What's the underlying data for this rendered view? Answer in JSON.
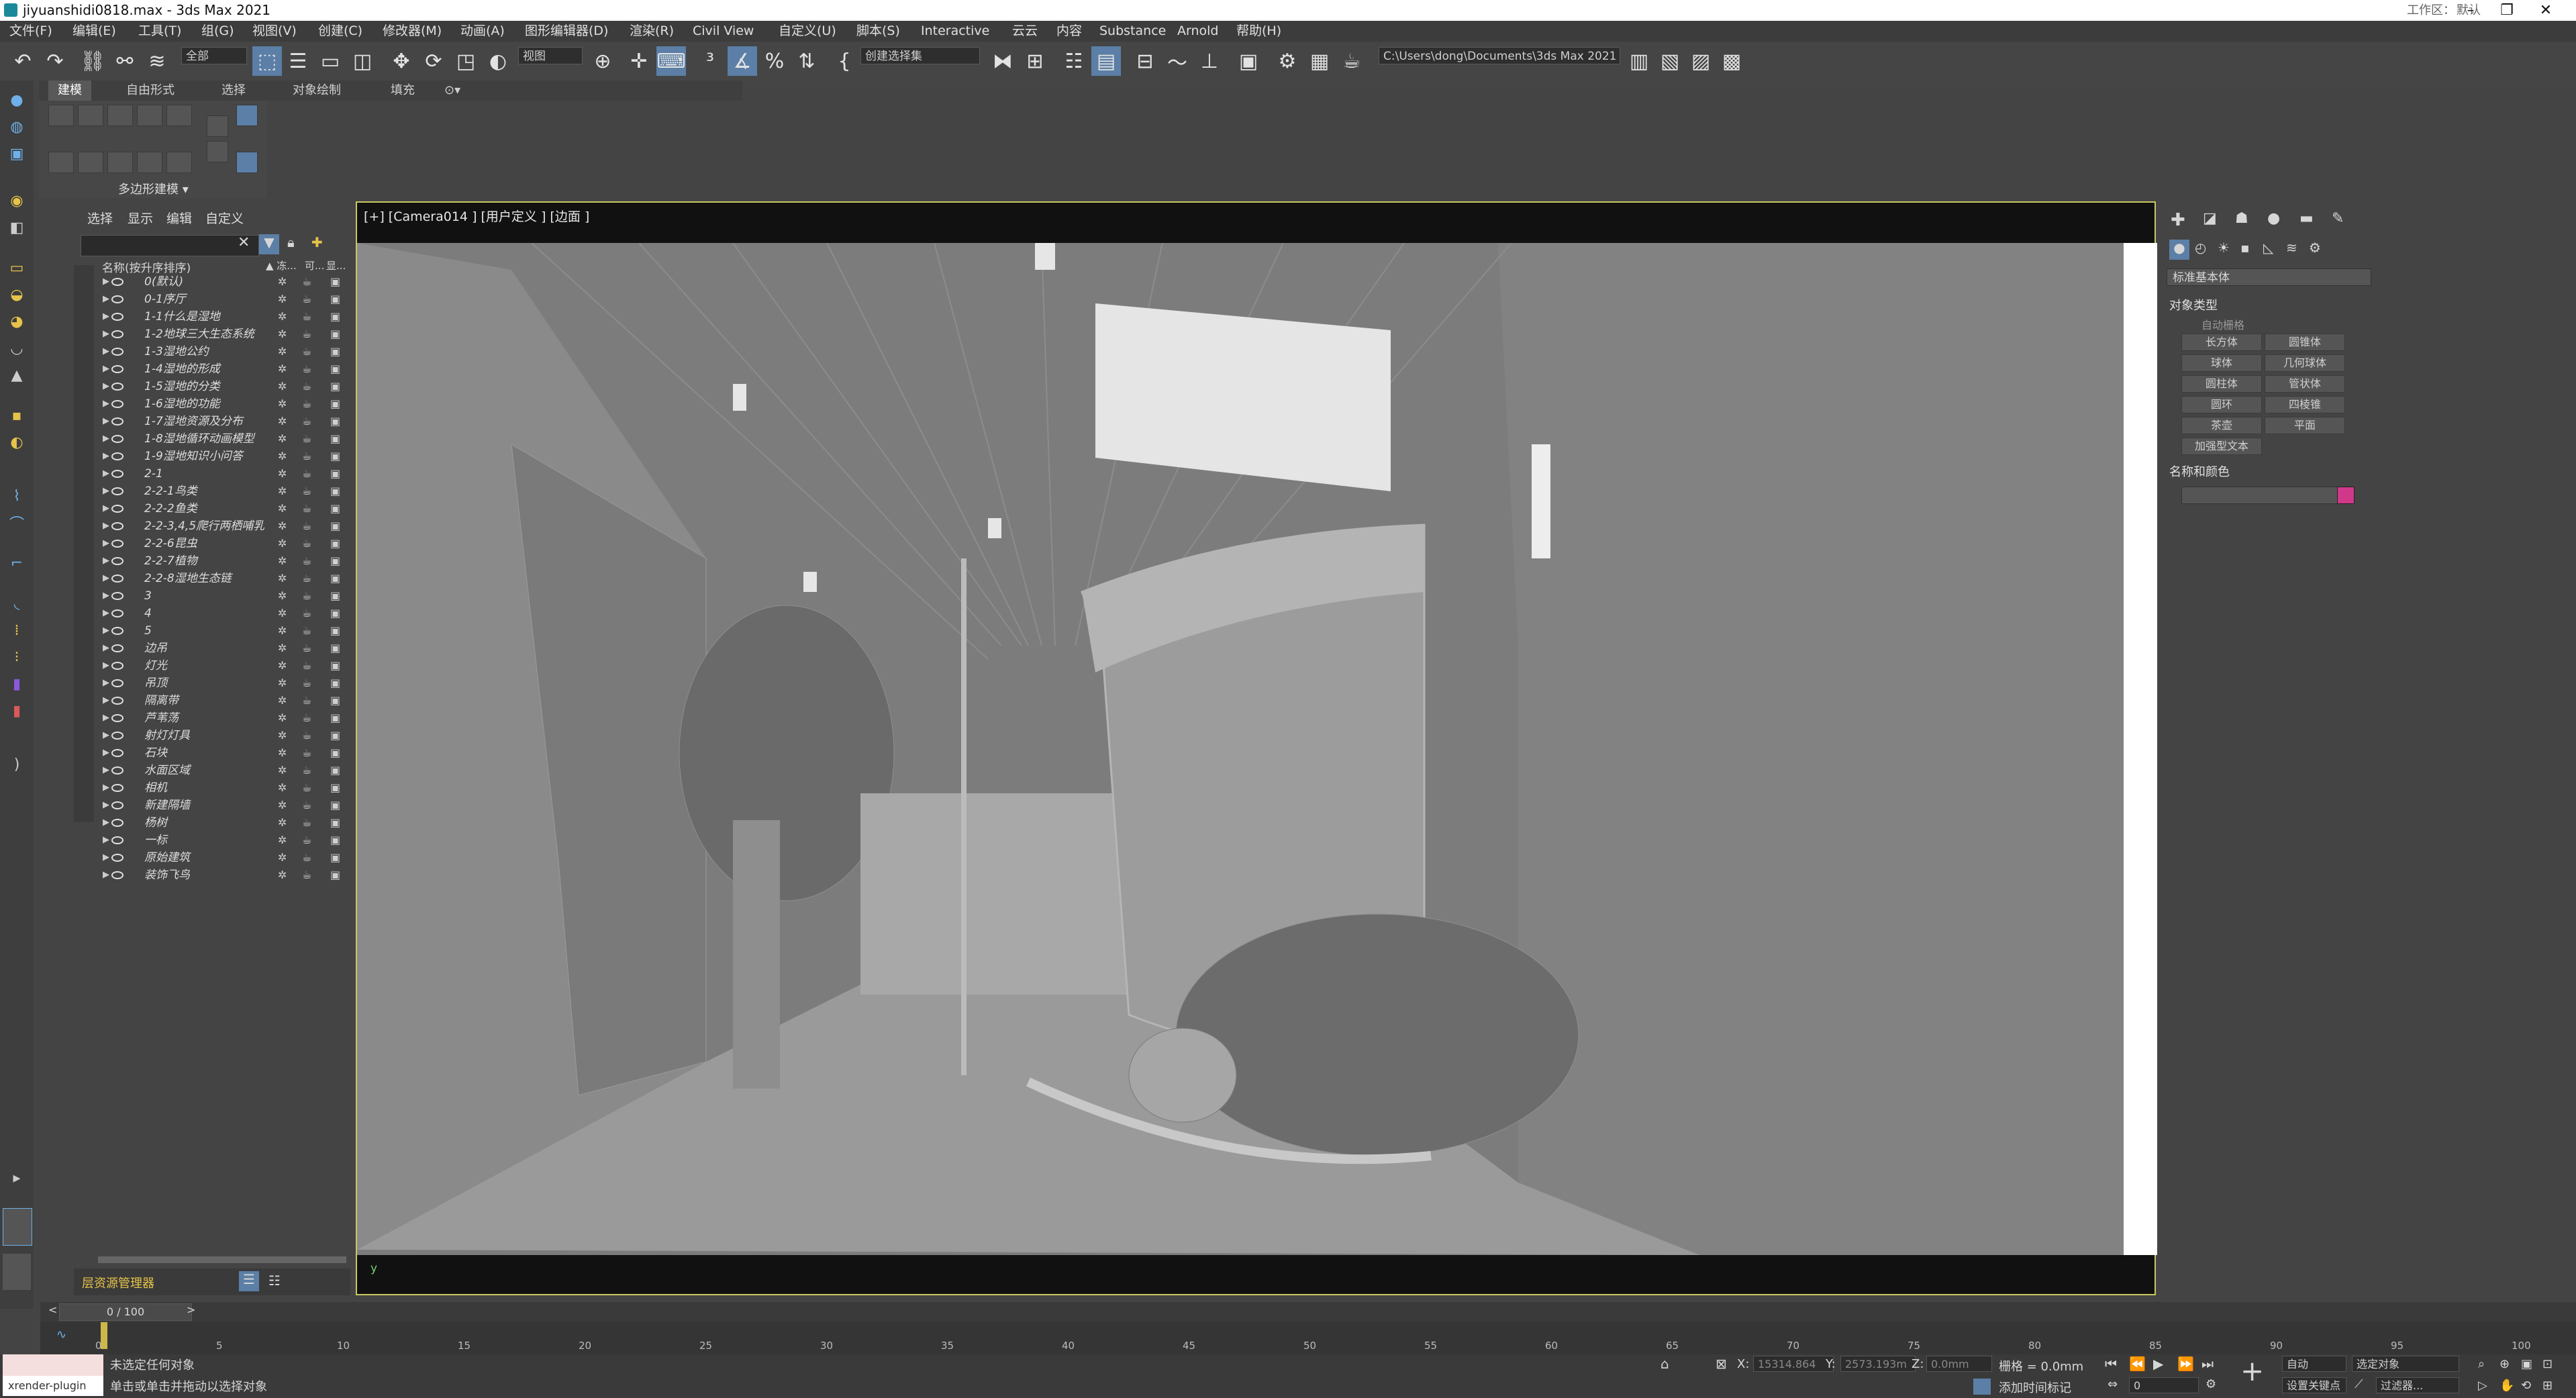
{
  "window": {
    "title": "jiyuanshidi0818.max - 3ds Max 2021",
    "workspace_label": "工作区：",
    "workspace_value": "默认"
  },
  "menu": [
    "文件(F)",
    "编辑(E)",
    "工具(T)",
    "组(G)",
    "视图(V)",
    "创建(C)",
    "修改器(M)",
    "动画(A)",
    "图形编辑器(D)",
    "渲染(R)",
    "Civil View",
    "自定义(U)",
    "脚本(S)",
    "Interactive",
    "云云",
    "内容",
    "Substance",
    "Arnold",
    "帮助(H)"
  ],
  "toolbar": {
    "filter_select": "全部",
    "ref_coord_select": "视图",
    "selection_set_select": "创建选择集",
    "project_path": "C:\\Users\\dong\\Documents\\3ds Max 2021"
  },
  "ribbon": {
    "tabs": [
      "建模",
      "自由形式",
      "选择",
      "对象绘制",
      "填充"
    ],
    "active_tab": "建模",
    "panel_label": "多边形建模 ▾"
  },
  "explorer": {
    "tabs": [
      "选择",
      "显示",
      "编辑",
      "自定义"
    ],
    "column_header": "名称(按升序排序)",
    "col_freeze": "▲ 冻...",
    "col_render": "可...",
    "col_display": "显...",
    "layers": [
      "0(默认)",
      "0-1序厅",
      "1-1什么是湿地",
      "1-2地球三大生态系统",
      "1-3湿地公约",
      "1-4湿地的形成",
      "1-5湿地的分类",
      "1-6湿地的功能",
      "1-7湿地资源及分布",
      "1-8湿地循环动画模型",
      "1-9湿地知识小问答",
      "2-1",
      "2-2-1鸟类",
      "2-2-2鱼类",
      "2-2-3,4,5爬行两栖哺乳",
      "2-2-6昆虫",
      "2-2-7植物",
      "2-2-8湿地生态链",
      "3",
      "4",
      "5",
      "边吊",
      "灯光",
      "吊顶",
      "隔离带",
      "芦苇荡",
      "射灯灯具",
      "石块",
      "水面区域",
      "相机",
      "新建隔墙",
      "杨树",
      "一标",
      "原始建筑",
      "装饰飞鸟"
    ],
    "footer_label": "层资源管理器"
  },
  "viewport": {
    "label": "[+] [Camera014 ] [用户定义 ] [边面 ]",
    "axis_label": "y"
  },
  "command_panel": {
    "dropdown": "标准基本体",
    "rollout_object_type": "对象类型",
    "autogrid": "自动栅格",
    "buttons": [
      "长方体",
      "圆锥体",
      "球体",
      "几何球体",
      "圆柱体",
      "管状体",
      "圆环",
      "四棱锥",
      "茶壶",
      "平面",
      "加强型文本"
    ],
    "rollout_name_color": "名称和颜色",
    "object_color": "#d0388a"
  },
  "timeline": {
    "frame_display": "0 / 100",
    "ticks": [
      "0",
      "5",
      "10",
      "15",
      "20",
      "25",
      "30",
      "35",
      "40",
      "45",
      "50",
      "55",
      "60",
      "65",
      "70",
      "75",
      "80",
      "85",
      "90",
      "95",
      "100"
    ]
  },
  "status": {
    "maxscript_listener": "xrender-plugin",
    "line1": "未选定任何对象",
    "line2": "单击或单击并拖动以选择对象",
    "x_label": "X:",
    "x_value": "15314.864",
    "y_label": "Y:",
    "y_value": "2573.193m",
    "z_label": "Z:",
    "z_value": "0.0mm",
    "grid": "栅格 = 0.0mm",
    "add_time_tag": "添加时间标记",
    "auto_key": "自动",
    "set_key": "设置关键点",
    "selected_object": "选定对象",
    "filter": "过滤器...",
    "current_frame": "0"
  }
}
